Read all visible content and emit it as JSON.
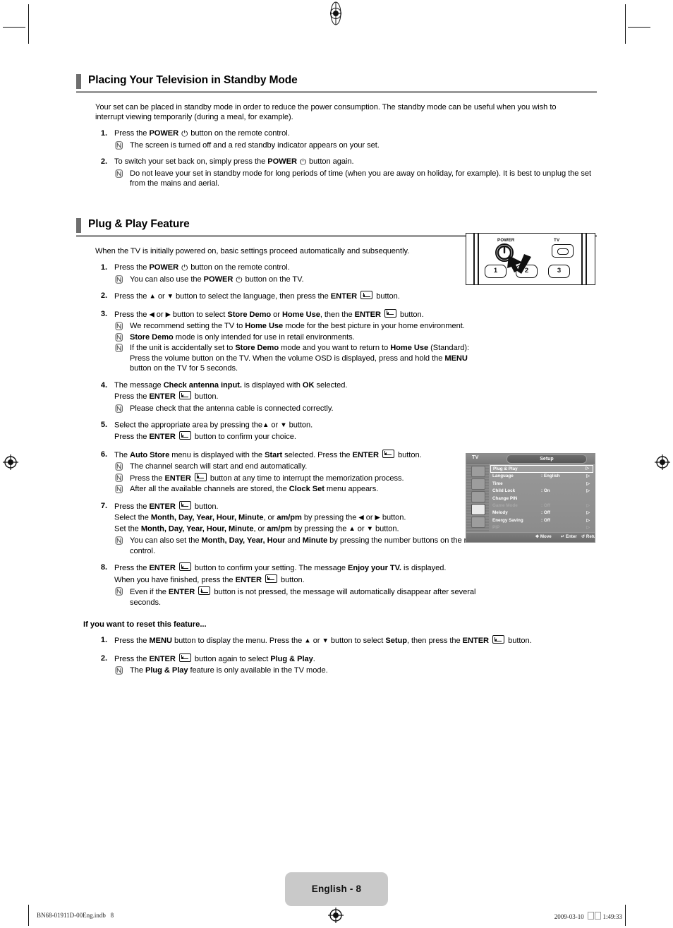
{
  "page": {
    "language_label": "English - 8",
    "footer_left": "BN68-01911D-00Eng.indb   8",
    "footer_date": "2009-03-10",
    "footer_time": "1:49:33"
  },
  "sections": [
    {
      "id": "standby",
      "title": "Placing Your Television in Standby Mode",
      "intro": "Your set can be placed in standby mode in order to reduce the power consumption. The standby mode can be useful when you wish to interrupt viewing temporarily (during a meal, for example).",
      "steps": [
        {
          "num": "1.",
          "lines": [
            "Press the |b:POWER| |icon:power| button on the remote control."
          ],
          "notes": [
            "The screen is turned off and a red standby indicator appears on your set."
          ]
        },
        {
          "num": "2.",
          "lines": [
            "To switch your set back on, simply press the |b:POWER| |icon:power| button again."
          ],
          "notes": [
            "Do not leave your set in standby mode for long periods of time (when you are away on holiday, for example). It is best to unplug the set from the mains and aerial."
          ]
        }
      ]
    },
    {
      "id": "plug-play",
      "title": "Plug & Play Feature",
      "intro": "When the TV is initially powered on, basic settings proceed automatically and subsequently.",
      "steps": [
        {
          "num": "1.",
          "lines": [
            "Press the |b:POWER| |icon:power| button on the remote control."
          ],
          "notes": [
            "You can also use the |b:POWER| |icon:power| button on the TV."
          ]
        },
        {
          "num": "2.",
          "lines": [
            "Press the |arr:▲| or |arr:▼| button to select the language, then press the |b:ENTER| |icon:enter| button."
          ],
          "notes": []
        },
        {
          "num": "3.",
          "lines": [
            "Press the |arr:◀| or |arr:▶| button to select |b:Store Demo| or |b:Home Use|, then the |b:ENTER| |icon:enter| button."
          ],
          "notes": [
            "We recommend setting the TV to |b:Home Use| mode for the best picture in your home environment.",
            "|b:Store Demo| mode is only intended for use in retail environments.",
            "If the unit is accidentally set to |b:Store Demo| mode and you want to return to |b:Home Use| (Standard): Press the volume button on the TV. When the volume OSD is displayed, press and hold the |b:MENU| button on the TV for 5 seconds."
          ]
        },
        {
          "num": "4.",
          "lines": [
            "The message |b:Check antenna input.| is displayed with |b:OK| selected.",
            "Press the |b:ENTER| |icon:enter| button."
          ],
          "notes": [
            "Please check that the antenna cable is connected correctly."
          ]
        },
        {
          "num": "5.",
          "lines": [
            "Select the appropriate area by pressing the|arr:▲| or |arr:▼| button.",
            "Press the |b:ENTER| |icon:enter| button to confirm your choice."
          ],
          "notes": []
        },
        {
          "num": "6.",
          "lines": [
            "The |b:Auto Store| menu is displayed with the |b:Start| selected. Press the |b:ENTER| |icon:enter| button."
          ],
          "notes": [
            "The channel search will start and end automatically.",
            "Press the |b:ENTER| |icon:enter| button at any time to interrupt the memorization process.",
            "After all the available channels are stored, the |b:Clock Set| menu appears."
          ]
        },
        {
          "num": "7.",
          "lines": [
            "Press the |b:ENTER| |icon:enter| button.",
            "Select the |b:Month, Day, Year, Hour, Minute|, or |b:am/pm| by pressing the |arr:◀| or |arr:▶| button.",
            "Set the |b:Month, Day, Year, Hour, Minute|, or |b:am/pm| by pressing the |arr:▲| or |arr:▼| button."
          ],
          "notes": [
            "You can also set the |b:Month, Day, Year, Hour| and |b:Minute| by pressing the number buttons on the remote control."
          ]
        },
        {
          "num": "8.",
          "lines": [
            "Press the |b:ENTER| |icon:enter| button to confirm your setting. The message |b:Enjoy your TV.| is displayed.",
            "When you have finished, press the |b:ENTER| |icon:enter| button."
          ],
          "notes": [
            "Even if the |b:ENTER| |icon:enter| button is not pressed, the message will automatically disappear after several seconds."
          ]
        }
      ],
      "reset_subhead": "If you want to reset this feature...",
      "reset_steps": [
        {
          "num": "1.",
          "lines": [
            "Press the |b:MENU| button to display the menu. Press the |arr:▲| or |arr:▼| button to select |b:Setup|, then press the |b:ENTER| |icon:enter| button."
          ],
          "notes": []
        },
        {
          "num": "2.",
          "lines": [
            "Press the |b:ENTER| |icon:enter| button again to select |b:Plug & Play|."
          ],
          "notes": [
            "The |b:Plug & Play| feature is only available in the TV mode."
          ]
        }
      ]
    }
  ],
  "figures": {
    "remote": {
      "power_label": "POWER",
      "tv_label": "TV",
      "buttons": [
        "1",
        "2",
        "3"
      ]
    },
    "setup_osd": {
      "source_label": "TV",
      "title": "Setup",
      "rows": [
        {
          "label": "Plug & Play",
          "value": "",
          "selected": true,
          "dim": false,
          "chevron": "▷"
        },
        {
          "label": "Language",
          "value": ": English",
          "selected": false,
          "dim": false,
          "chevron": "▷"
        },
        {
          "label": "Time",
          "value": "",
          "selected": false,
          "dim": false,
          "chevron": "▷"
        },
        {
          "label": "Child Lock",
          "value": ": On",
          "selected": false,
          "dim": false,
          "chevron": "▷"
        },
        {
          "label": "Change PIN",
          "value": "",
          "selected": false,
          "dim": false,
          "chevron": ""
        },
        {
          "label": "Game Mode",
          "value": ": Off",
          "selected": false,
          "dim": true,
          "chevron": "▷"
        },
        {
          "label": "Melody",
          "value": ": Off",
          "selected": false,
          "dim": false,
          "chevron": "▷"
        },
        {
          "label": "Energy Saving",
          "value": ": Off",
          "selected": false,
          "dim": false,
          "chevron": "▷"
        },
        {
          "label": "PIP",
          "value": "",
          "selected": false,
          "dim": true,
          "chevron": "▷"
        }
      ],
      "footer": [
        {
          "icon": "✥",
          "label": "Move"
        },
        {
          "icon": "↵",
          "label": "Enter"
        },
        {
          "icon": "↺",
          "label": "Return"
        }
      ]
    }
  },
  "colors": {
    "heading_bar": "#6e6e6e",
    "heading_rule": "#9a9a9a",
    "page_badge": "#c9c9c9",
    "osd_bg": "#8d8d8d"
  }
}
